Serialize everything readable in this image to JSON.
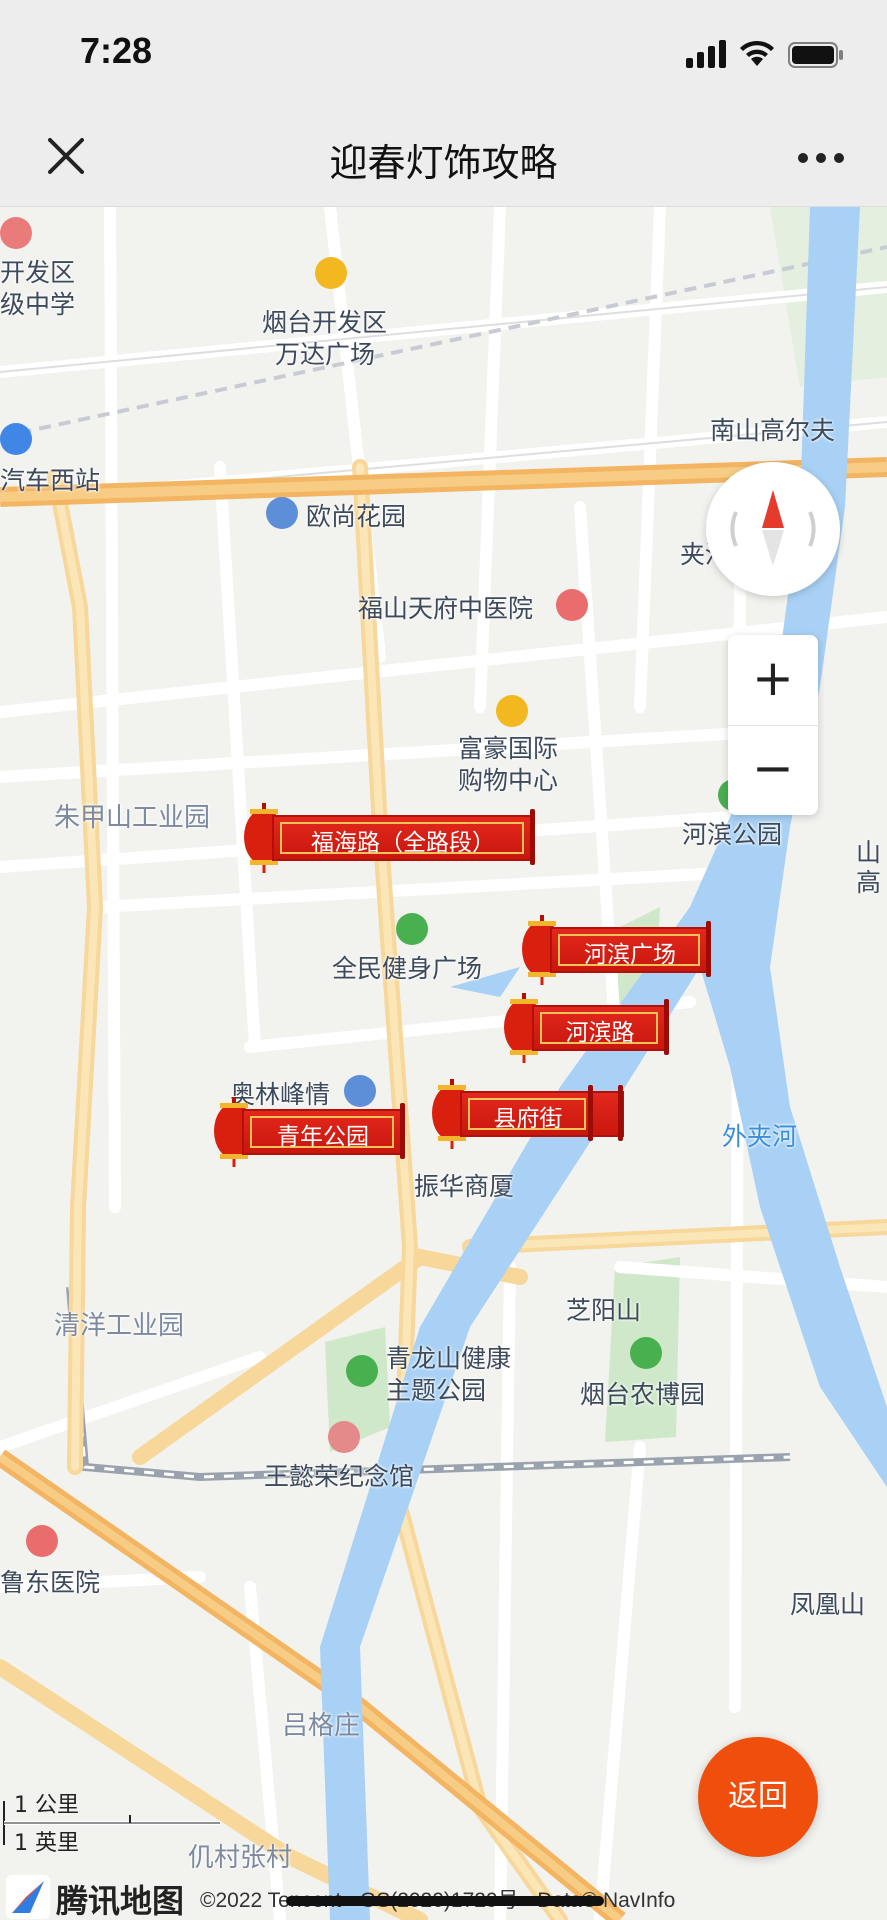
{
  "status_bar": {
    "time": "7:28"
  },
  "nav": {
    "title": "迎春灯饰攻略",
    "close_icon": "close-icon",
    "more_icon": "more-icon"
  },
  "map": {
    "labels": {
      "kaifaqu": "开发区",
      "jizhongxue": "级中学",
      "wanda_1": "烟台开发区",
      "wanda_2": "万达广场",
      "bus_west": "汽车西站",
      "nanshan": "南山高尔夫",
      "oushang": "欧尚花园",
      "jiahe": "夹河",
      "hospital_tcm": "福山天府中医院",
      "fuhao_1": "富豪国际",
      "fuhao_2": "购物中心",
      "zhujiashan": "朱甲山工业园",
      "hebin_park": "河滨公园",
      "shan_right_1": "山",
      "shan_right_2": "高",
      "quanmin": "全民健身广场",
      "aolin": "奥林峰情",
      "zhenhua": "振华商厦",
      "waijiahe": "外夹河",
      "qingyang": "清洋工业园",
      "zhiyangshan": "芝阳山",
      "qinglong_1": "青龙山健康",
      "qinglong_2": "主题公园",
      "nongbo": "烟台农博园",
      "wangyirong": "王懿荣纪念馆",
      "ludong": "鲁东医院",
      "fenghuangshan": "凤凰山",
      "lvgezhuang": "吕格庄",
      "zhangcun": "仉村张村"
    },
    "lanterns": [
      {
        "label": "福海路（全路段）"
      },
      {
        "label": "河滨广场"
      },
      {
        "label": "河滨路"
      },
      {
        "label": "县府街"
      },
      {
        "label": "青年公园"
      }
    ],
    "controls": {
      "compass_icon": "compass-icon",
      "zoom_in": "+",
      "zoom_out": "−",
      "back": "返回"
    },
    "scale": {
      "km": "1 公里",
      "mi": "1 英里"
    },
    "footer": {
      "brand": "腾讯地图",
      "copyright": "©2022 Tencent - GS(2020)1729号 - Data© NavInfo"
    }
  },
  "colors": {
    "river": "#a8d1f5",
    "highway": "#f7c87a",
    "lantern_red": "#d9200f",
    "back_button": "#f04e0c"
  }
}
